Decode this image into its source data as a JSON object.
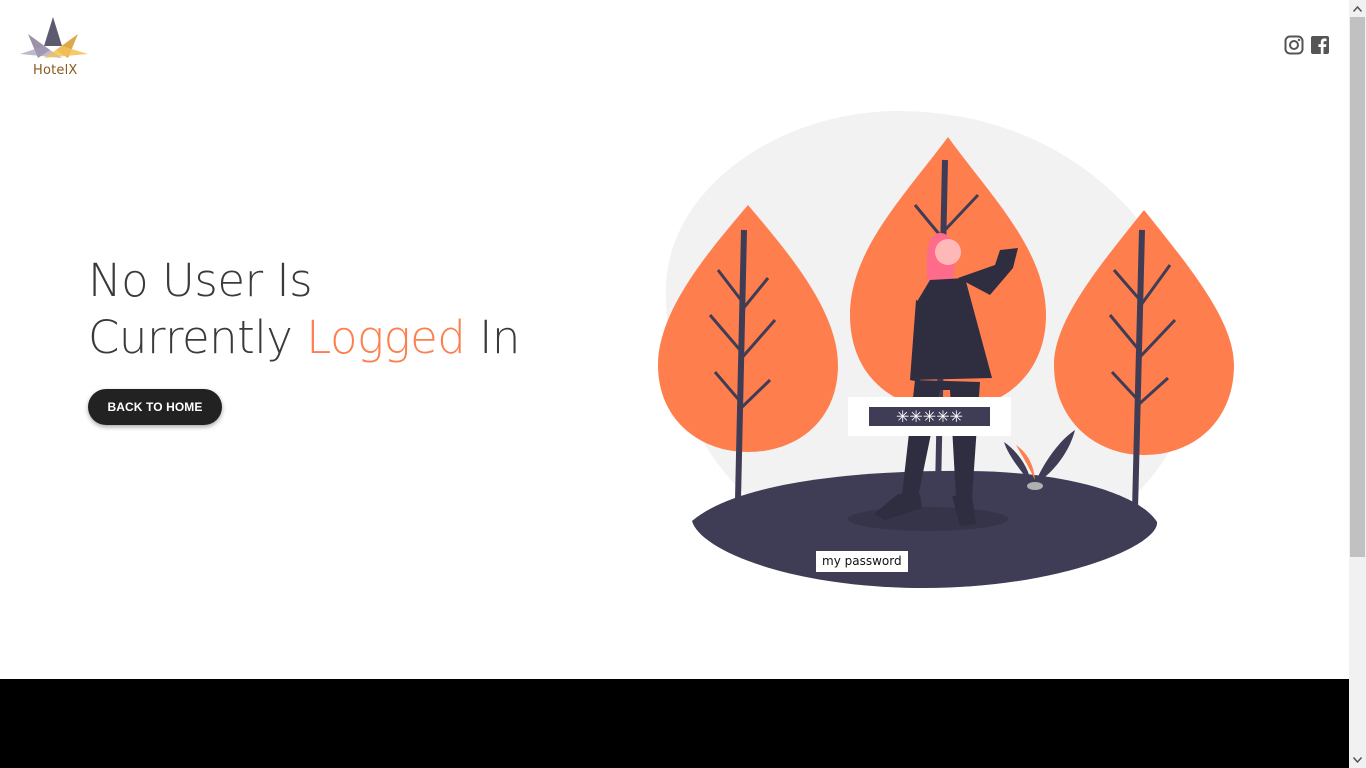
{
  "brand": {
    "name": "HotelX"
  },
  "social": [
    {
      "name": "instagram-icon"
    },
    {
      "name": "facebook-icon"
    }
  ],
  "hero": {
    "line1": "No User Is",
    "line2_prefix": "Currently ",
    "line2_accent": "Logged",
    "line2_suffix": " In",
    "button_label": "BACK TO HOME"
  },
  "illustration": {
    "password_mask": "✳✳✳✳✳",
    "caption": "my password"
  },
  "colors": {
    "accent": "#ff7e4d",
    "dark": "#3f3d56",
    "button": "#222222",
    "footer": "#000000"
  }
}
